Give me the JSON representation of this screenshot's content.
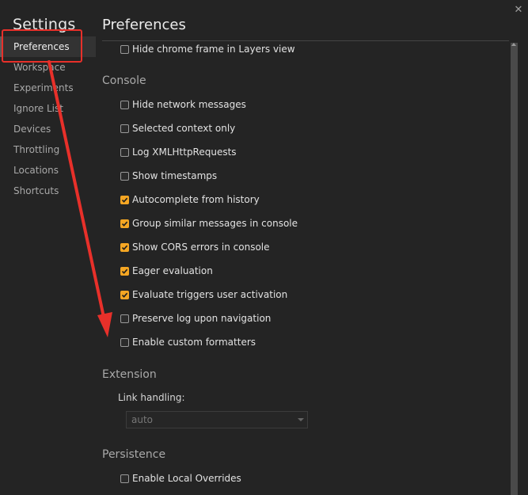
{
  "sidebar": {
    "title": "Settings",
    "items": [
      {
        "label": "Preferences"
      },
      {
        "label": "Workspace"
      },
      {
        "label": "Experiments"
      },
      {
        "label": "Ignore List"
      },
      {
        "label": "Devices"
      },
      {
        "label": "Throttling"
      },
      {
        "label": "Locations"
      },
      {
        "label": "Shortcuts"
      }
    ]
  },
  "header": {
    "title": "Preferences",
    "close_glyph": "✕"
  },
  "sections": {
    "top": {
      "items": [
        {
          "label": "Hide chrome frame in Layers view",
          "checked": false
        }
      ]
    },
    "console": {
      "title": "Console",
      "items": [
        {
          "label": "Hide network messages",
          "checked": false
        },
        {
          "label": "Selected context only",
          "checked": false
        },
        {
          "label": "Log XMLHttpRequests",
          "checked": false
        },
        {
          "label": "Show timestamps",
          "checked": false
        },
        {
          "label": "Autocomplete from history",
          "checked": true
        },
        {
          "label": "Group similar messages in console",
          "checked": true
        },
        {
          "label": "Show CORS errors in console",
          "checked": true
        },
        {
          "label": "Eager evaluation",
          "checked": true
        },
        {
          "label": "Evaluate triggers user activation",
          "checked": true
        },
        {
          "label": "Preserve log upon navigation",
          "checked": false
        },
        {
          "label": "Enable custom formatters",
          "checked": false
        }
      ]
    },
    "extension": {
      "title": "Extension",
      "link_handling_label": "Link handling:",
      "link_handling_value": "auto"
    },
    "persistence": {
      "title": "Persistence",
      "items": [
        {
          "label": "Enable Local Overrides",
          "checked": false
        }
      ]
    }
  },
  "colors": {
    "accent_checkbox": "#f5a623",
    "annotation_red": "#e8302a",
    "background": "#242424"
  },
  "icons": {
    "close": "close-icon",
    "dropdown": "chevron-down-icon",
    "check": "checkmark-icon"
  }
}
